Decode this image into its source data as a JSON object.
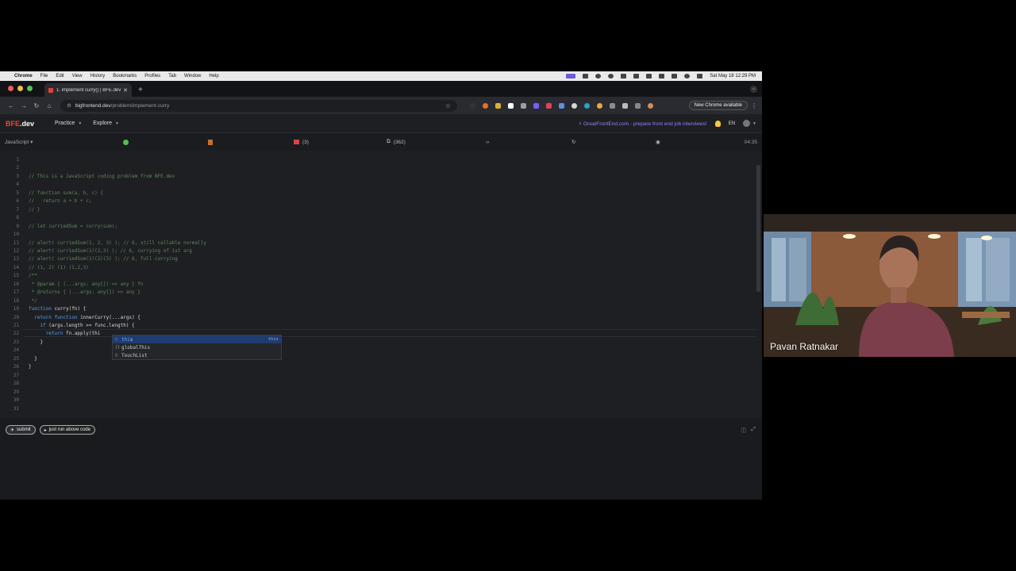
{
  "menubar": {
    "app": "Chrome",
    "items": [
      "File",
      "Edit",
      "View",
      "History",
      "Bookmarks",
      "Profiles",
      "Tab",
      "Window",
      "Help"
    ],
    "clock": "Sat May 18  12:29 PM"
  },
  "browser": {
    "tab_title": "1. implement curry() | BFE.dev",
    "url_host": "bigfrontend.dev",
    "url_path": "/problem/implement-curry",
    "new_chrome": "New Chrome available"
  },
  "site": {
    "logo_main": "BFE",
    "logo_suffix": ".dev",
    "nav": [
      "Practice",
      "Explore"
    ],
    "promo": "GreatFrontEnd.com - prepare front end job interviews!",
    "lang": "EN"
  },
  "editor_bar": {
    "language": "JavaScript",
    "discuss_count": "(3)",
    "solutions_count": "(362)",
    "timer": "04:35"
  },
  "code": {
    "line_numbers": [
      "1",
      "2",
      "3",
      "4",
      "5",
      "6",
      "7",
      "8",
      "9",
      "10",
      "11",
      "12",
      "13",
      "14",
      "15",
      "16",
      "17",
      "18",
      "19",
      "20",
      "21",
      "22",
      "23",
      "24",
      "25",
      "26",
      "27",
      "28",
      "29",
      "30",
      "31"
    ],
    "lines": [
      "",
      "",
      "// This is a JavaScript coding problem from BFE.dev",
      "",
      "// function sum(a, b, c) {",
      "//   return a + b + c;",
      "// }",
      "",
      "// let curriedSum = curry(sum);",
      "",
      "// alert( curriedSum(1, 2, 3) ); // 6, still callable normally",
      "// alert( curriedSum(1)(2,3) ); // 6, currying of 1st arg",
      "// alert( curriedSum(1)(2)(3) ); // 6, full currying",
      "// (1, 2) (1) (1,2,3)",
      "/**",
      " * @param { (...args: any[]) => any } fn",
      " * @returns { (...args: any[]) => any }",
      " */",
      "function curry(fn) {",
      "  return function innerCurry(...args) {",
      "    if (args.length >= func.length) {",
      "      return fn.apply(thi",
      "    }",
      "",
      "  }",
      "}",
      "",
      "",
      "",
      "",
      ""
    ]
  },
  "suggestions": [
    {
      "icon": "keyword",
      "match": "thi",
      "rest": "s",
      "detail": "this"
    },
    {
      "icon": "variable",
      "match": "",
      "rest": "globalThis",
      "detail": ""
    },
    {
      "icon": "class",
      "match": "",
      "rest": "TouchList",
      "detail": ""
    }
  ],
  "bottom": {
    "submit": "submit",
    "run": "just run above code"
  },
  "webcam": {
    "name": "Pavan Ratnakar"
  },
  "colors": {
    "brand": "#e8482f",
    "promo": "#8f82ff",
    "comment": "#5d8a55",
    "keyword": "#5f9de8"
  }
}
